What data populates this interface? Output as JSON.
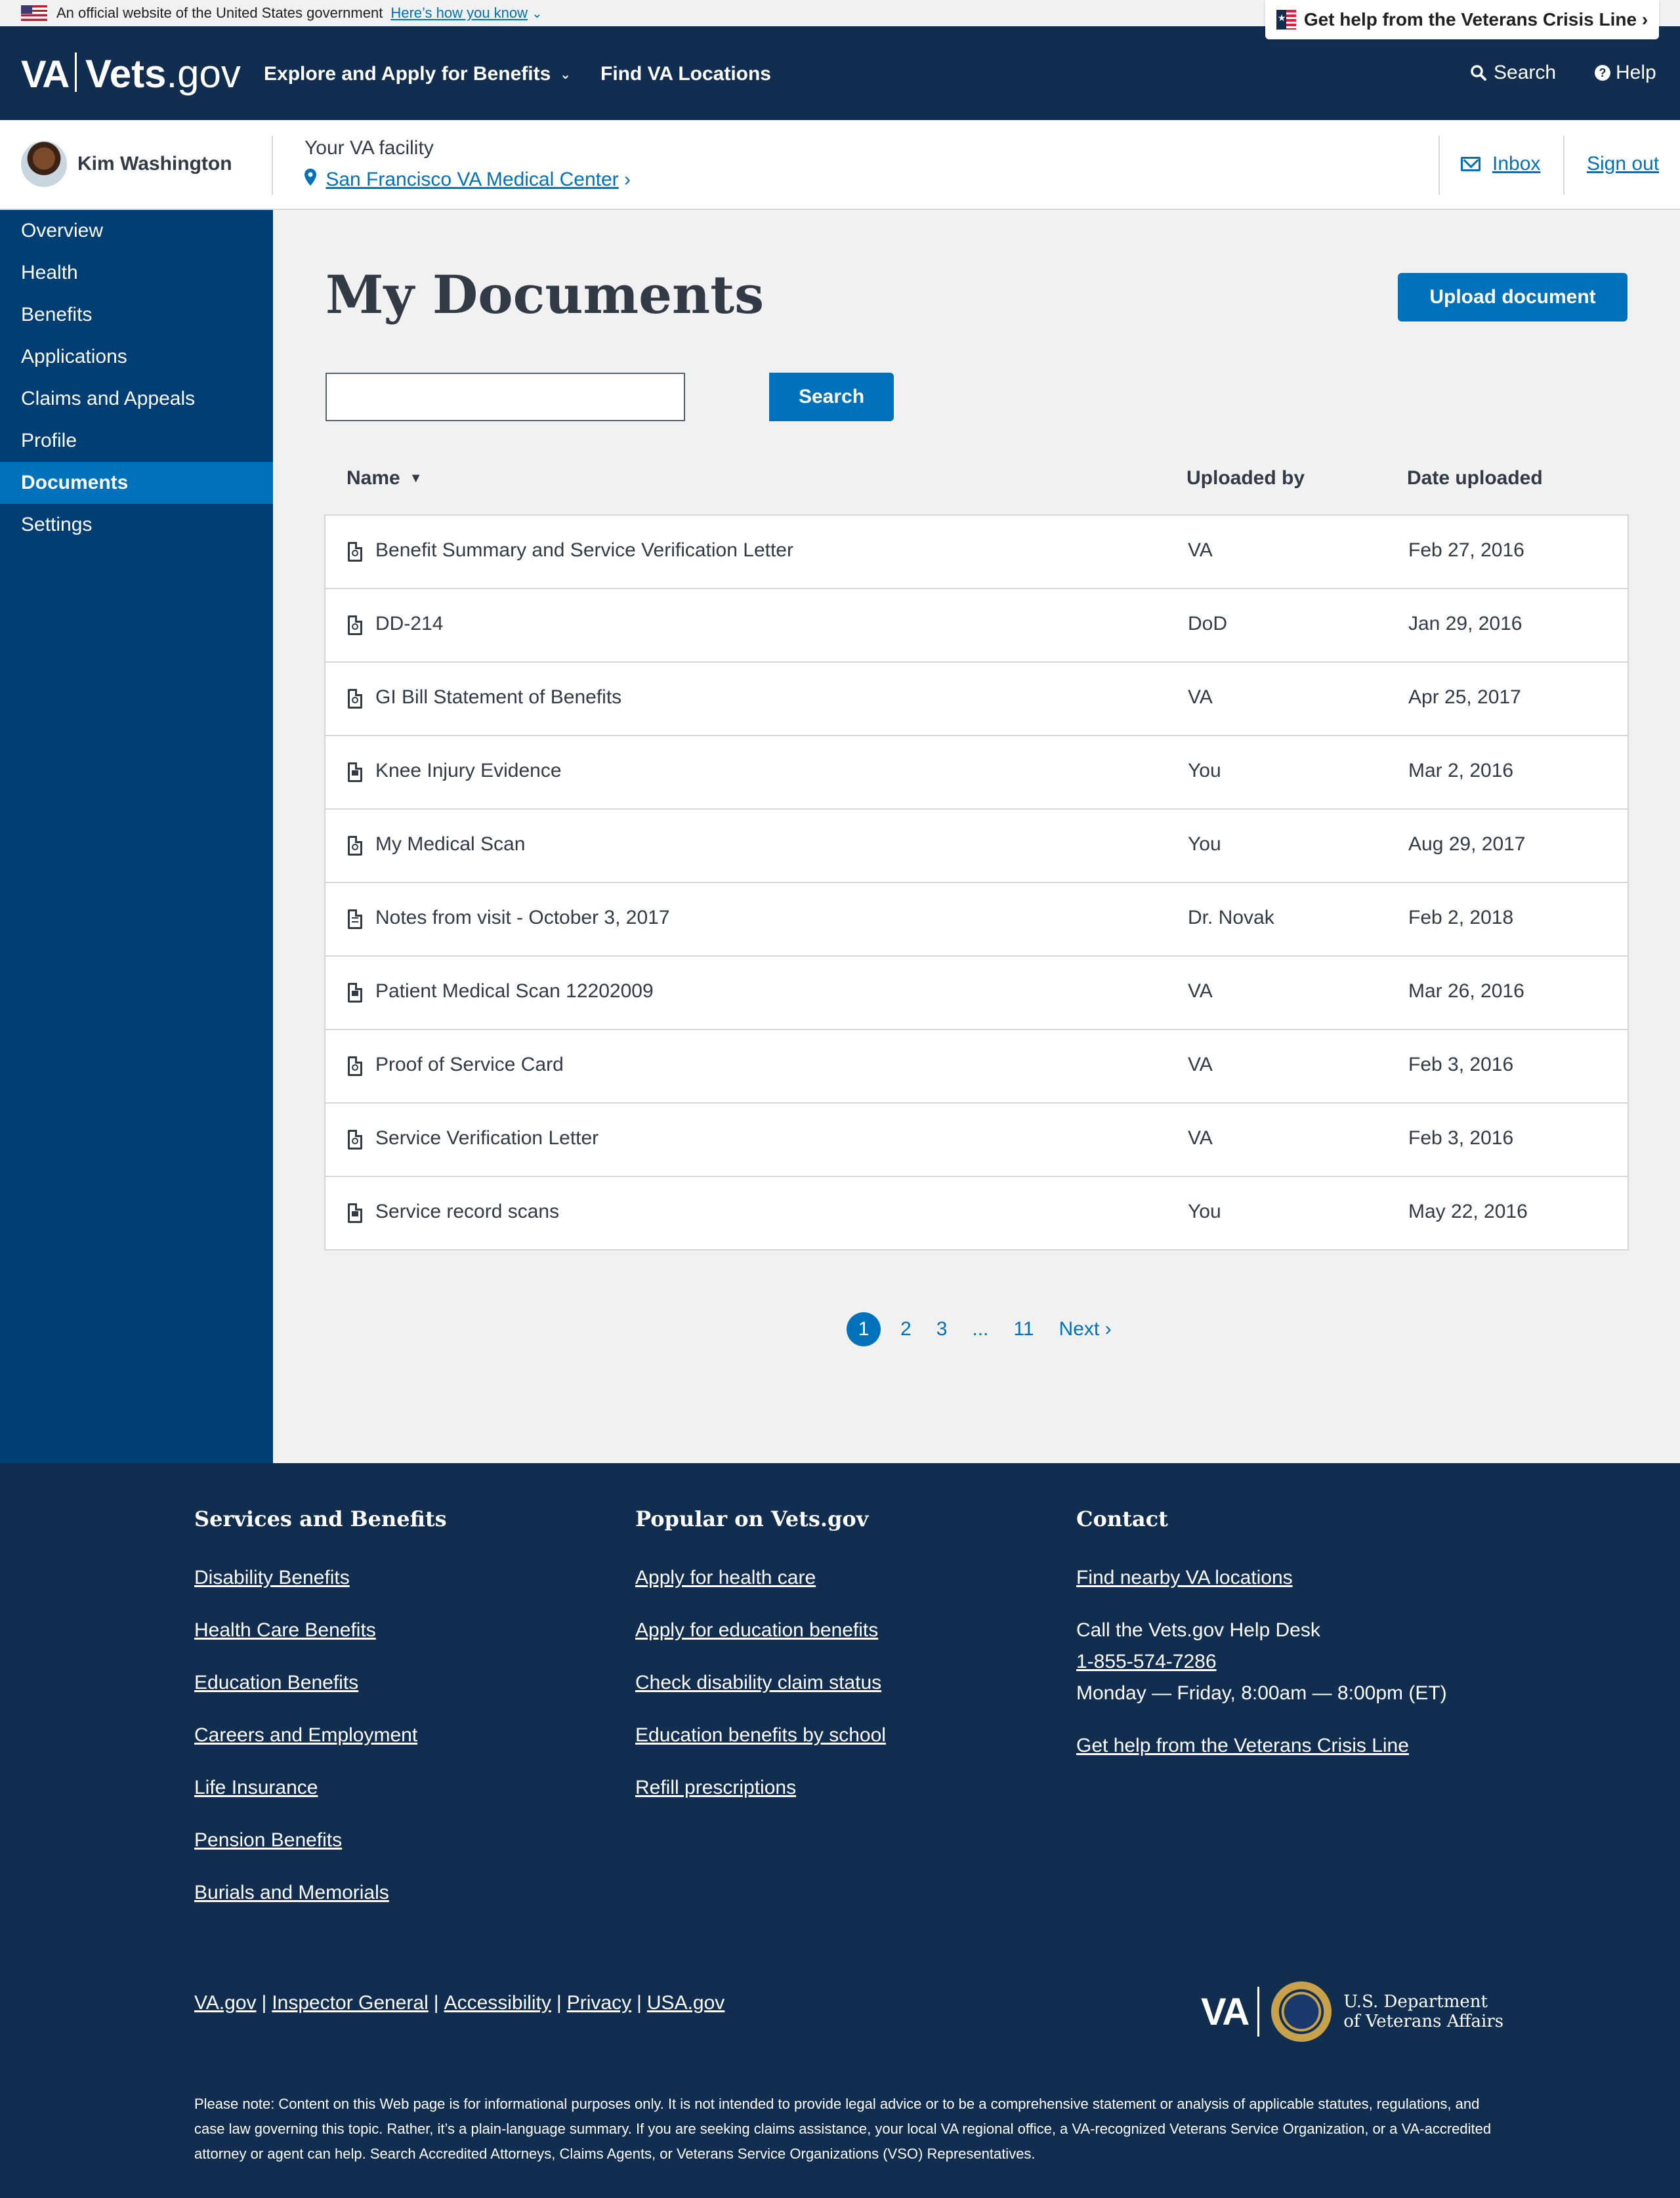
{
  "gov_banner": {
    "text": "An official website of the United States government",
    "how_link": "Here’s how you know",
    "how_chevron": "⌄"
  },
  "crisis": {
    "label": "Get help from the Veterans Crisis Line ›"
  },
  "header": {
    "logo_va": "VA",
    "logo_vets": "Vets",
    "logo_gov": ".gov",
    "nav_explore": "Explore and Apply for Benefits",
    "nav_explore_caret": "⌄",
    "nav_find": "Find VA Locations",
    "search_label": "Search",
    "help_label": "Help",
    "search_icon": "search-icon",
    "help_icon": "help-icon"
  },
  "userbar": {
    "name": "Kim Washington",
    "facility_label": "Your VA facility",
    "facility_name": "San Francisco VA Medical Center",
    "facility_chevron": "›",
    "inbox": "Inbox",
    "signout": "Sign out"
  },
  "sidebar": {
    "items": [
      {
        "label": "Overview"
      },
      {
        "label": "Health"
      },
      {
        "label": "Benefits"
      },
      {
        "label": "Applications"
      },
      {
        "label": "Claims and Appeals"
      },
      {
        "label": "Profile"
      },
      {
        "label": "Documents"
      },
      {
        "label": "Settings"
      }
    ],
    "active": "Documents"
  },
  "main": {
    "title": "My Documents",
    "upload_label": "Upload document",
    "search_value": "",
    "search_button": "Search",
    "columns": {
      "name": "Name",
      "uploaded_by": "Uploaded by",
      "date": "Date uploaded"
    },
    "sort_indicator": "▼",
    "rows": [
      {
        "name": "Benefit Summary and Service Verification Letter",
        "uploaded_by": "VA",
        "date": "Feb 27, 2016",
        "icon": "pdf-file-icon"
      },
      {
        "name": "DD-214",
        "uploaded_by": "DoD",
        "date": "Jan 29, 2016",
        "icon": "pdf-file-icon"
      },
      {
        "name": "GI Bill Statement of Benefits",
        "uploaded_by": "VA",
        "date": "Apr 25, 2017",
        "icon": "pdf-file-icon"
      },
      {
        "name": "Knee Injury Evidence",
        "uploaded_by": "You",
        "date": "Mar 2, 2016",
        "icon": "image-file-icon"
      },
      {
        "name": "My Medical Scan",
        "uploaded_by": "You",
        "date": "Aug 29, 2017",
        "icon": "pdf-file-icon"
      },
      {
        "name": "Notes from visit - October 3, 2017",
        "uploaded_by": "Dr. Novak",
        "date": "Feb 2, 2018",
        "icon": "text-file-icon"
      },
      {
        "name": "Patient Medical Scan 12202009",
        "uploaded_by": "VA",
        "date": "Mar 26, 2016",
        "icon": "image-file-icon"
      },
      {
        "name": "Proof of Service Card",
        "uploaded_by": "VA",
        "date": "Feb 3, 2016",
        "icon": "pdf-file-icon"
      },
      {
        "name": "Service Verification Letter",
        "uploaded_by": "VA",
        "date": "Feb 3, 2016",
        "icon": "pdf-file-icon"
      },
      {
        "name": "Service record scans",
        "uploaded_by": "You",
        "date": "May 22, 2016",
        "icon": "image-file-icon"
      }
    ],
    "pagination": {
      "pages": [
        "1",
        "2",
        "3",
        "...",
        "11"
      ],
      "current": "1",
      "next": "Next ›"
    }
  },
  "footer": {
    "services": {
      "heading": "Services and Benefits",
      "links": [
        "Disability Benefits",
        "Health Care Benefits",
        "Education Benefits",
        "Careers and Employment",
        "Life Insurance",
        "Pension Benefits",
        "Burials and Memorials"
      ]
    },
    "popular": {
      "heading": "Popular on Vets.gov",
      "links": [
        "Apply for health care",
        "Apply for education benefits",
        "Check disability claim status",
        "Education benefits by school",
        "Refill prescriptions"
      ]
    },
    "contact": {
      "heading": "Contact",
      "find_link": "Find nearby VA locations",
      "call_text": "Call the Vets.gov Help Desk",
      "phone": "1-855-574-7286",
      "hours": "Monday — Friday, 8:00am — 8:00pm (ET)",
      "crisis_link": "Get help from the Veterans Crisis Line"
    },
    "bottom_links": [
      "VA.gov",
      "Inspector General",
      "Accessibility",
      "Privacy",
      "USA.gov"
    ],
    "logo_va": "VA",
    "dept_line1": "U.S. Department",
    "dept_line2": "of Veterans Affairs",
    "note": "Please note: Content on this Web page is for informational purposes only. It is not intended to provide legal advice or to be a comprehensive statement or analysis of applicable statutes, regulations, and case law governing this topic. Rather, it’s a plain-language summary. If you are seeking claims assistance, your local VA regional office, a VA-recognized Veterans Service Organization, or a VA-accredited attorney or agent can help. Search Accredited Attorneys, Claims Agents, or Veterans Service Organizations (VSO) Representatives."
  }
}
